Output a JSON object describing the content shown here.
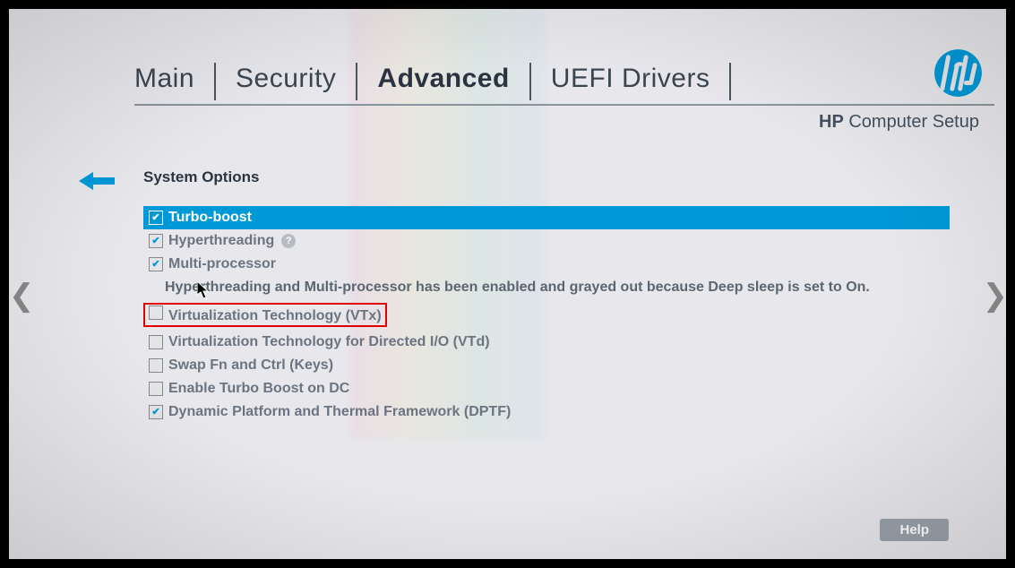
{
  "brand_prefix": "HP",
  "brand_suffix": " Computer Setup",
  "tabs": [
    "Main",
    "Security",
    "Advanced",
    "UEFI Drivers"
  ],
  "active_tab": 2,
  "section_title": "System Options",
  "note": "Hyperthreading and Multi-processor has been enabled and grayed out because Deep sleep is set to On.",
  "options": [
    {
      "label": "Turbo-boost",
      "checked": true,
      "selected": true,
      "disabled": false,
      "help": false,
      "highlight": false
    },
    {
      "label": "Hyperthreading",
      "checked": true,
      "selected": false,
      "disabled": true,
      "help": true,
      "highlight": false
    },
    {
      "label": "Multi-processor",
      "checked": true,
      "selected": false,
      "disabled": true,
      "help": false,
      "highlight": false
    },
    {
      "label": "Virtualization Technology (VTx)",
      "checked": false,
      "selected": false,
      "disabled": false,
      "help": false,
      "highlight": true
    },
    {
      "label": "Virtualization Technology for Directed I/O (VTd)",
      "checked": false,
      "selected": false,
      "disabled": false,
      "help": false,
      "highlight": false
    },
    {
      "label": "Swap Fn and Ctrl (Keys)",
      "checked": false,
      "selected": false,
      "disabled": false,
      "help": false,
      "highlight": false
    },
    {
      "label": "Enable Turbo Boost on DC",
      "checked": false,
      "selected": false,
      "disabled": false,
      "help": false,
      "highlight": false
    },
    {
      "label": "Dynamic Platform and Thermal Framework (DPTF)",
      "checked": true,
      "selected": false,
      "disabled": false,
      "help": false,
      "highlight": false
    }
  ],
  "help_button": "Help"
}
